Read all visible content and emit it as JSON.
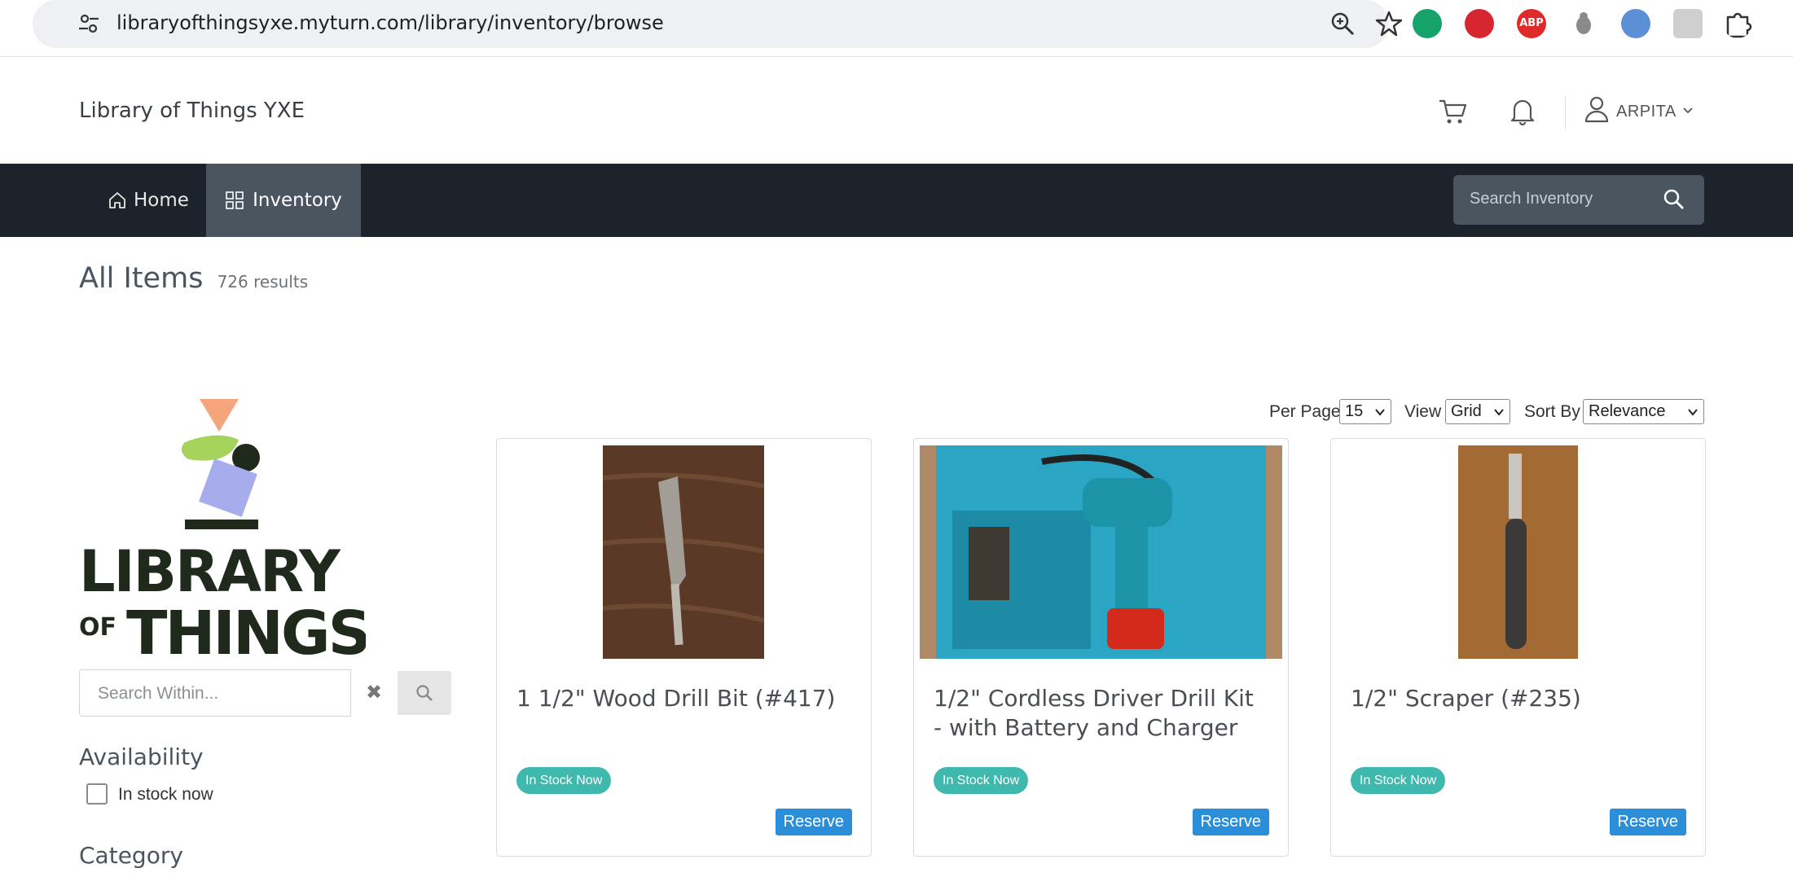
{
  "browser": {
    "url": "libraryofthingsyxe.myturn.com/library/inventory/browse",
    "abp_label": "ABP"
  },
  "header": {
    "brand": "Library of Things YXE",
    "user_name": "ARPITA"
  },
  "nav": {
    "home_label": "Home",
    "inventory_label": "Inventory",
    "search_placeholder": "Search Inventory"
  },
  "page": {
    "title": "All Items",
    "count": "726 results"
  },
  "sidebar": {
    "search_placeholder": "Search Within...",
    "availability_heading": "Availability",
    "in_stock_label": "In stock now",
    "category_heading": "Category",
    "logo_line1": "LIBRARY",
    "logo_line2_small": "OF",
    "logo_line2_big": "THINGS"
  },
  "controls": {
    "per_page_label": "Per Page",
    "per_page_value": "15",
    "view_label": "View",
    "view_value": "Grid",
    "sort_label": "Sort By",
    "sort_value": "Relevance"
  },
  "items": [
    {
      "title": "1 1/2\" Wood Drill Bit (#417)",
      "status": "In Stock Now",
      "action": "Reserve"
    },
    {
      "title": "1/2\" Cordless Driver Drill Kit - with Battery and Charger",
      "status": "In Stock Now",
      "action": "Reserve"
    },
    {
      "title": "1/2\" Scraper (#235)",
      "status": "In Stock Now",
      "action": "Reserve"
    }
  ],
  "colors": {
    "nav_bg": "#1c232b",
    "nav_active": "#4a5560",
    "badge": "#3fb8ad",
    "reserve": "#2a8fd8"
  }
}
